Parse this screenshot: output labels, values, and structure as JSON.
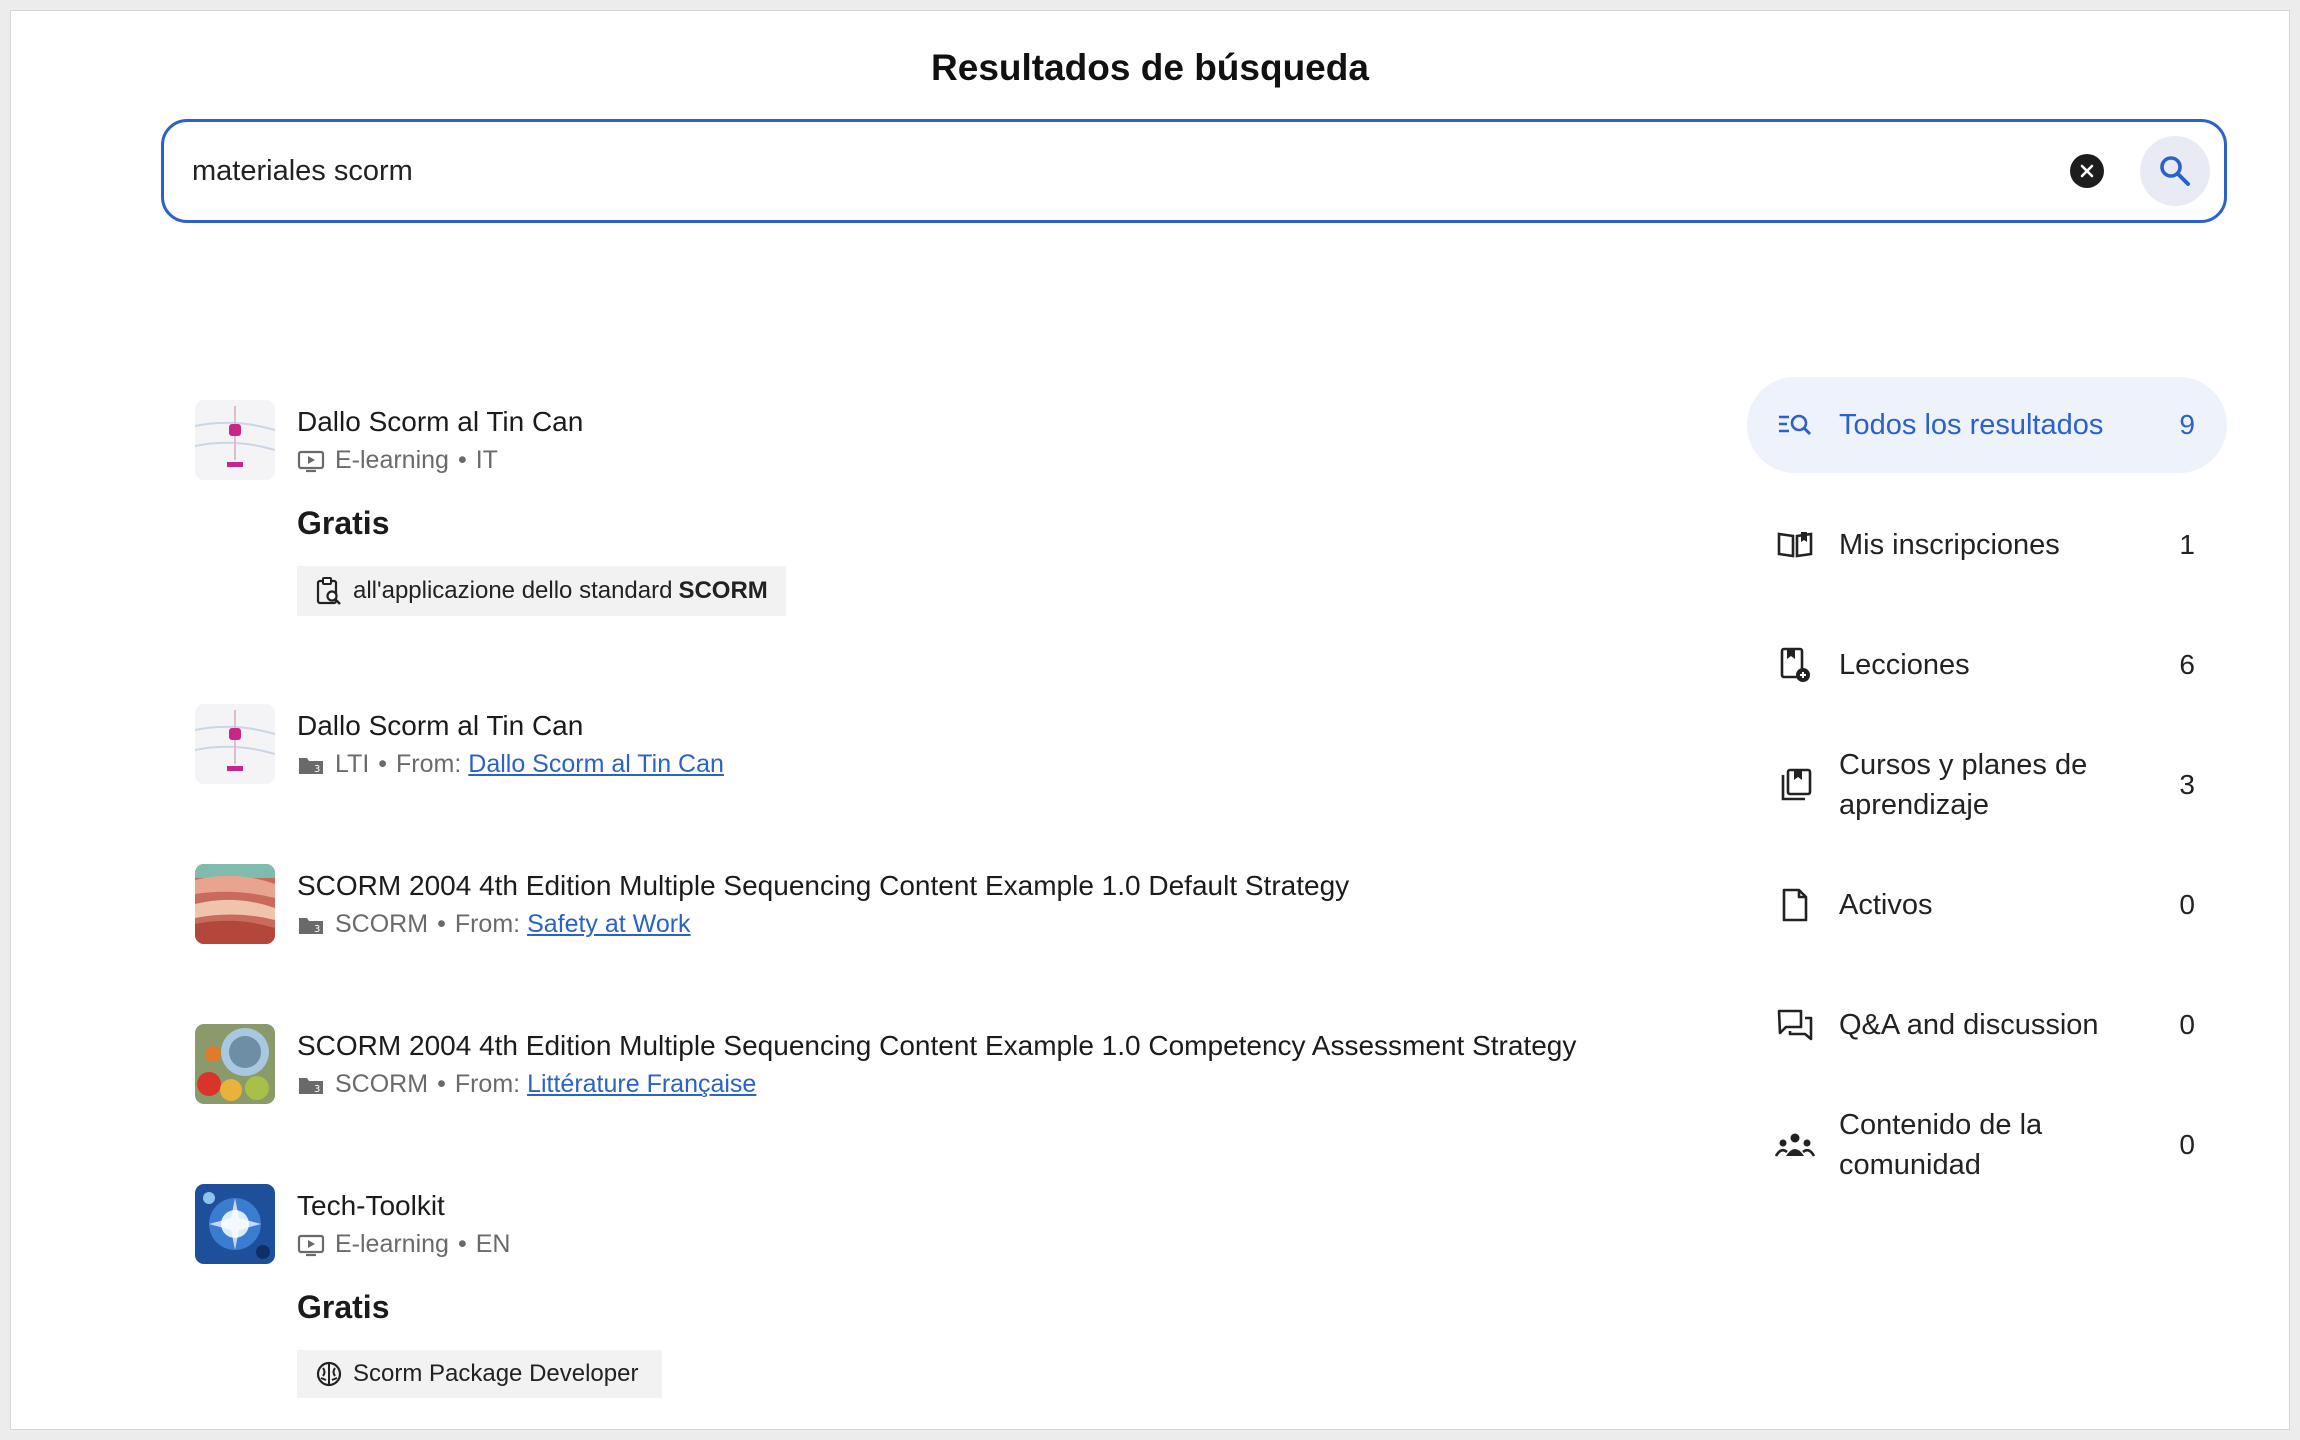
{
  "page": {
    "title": "Resultados de búsqueda"
  },
  "search": {
    "value": "materiales scorm"
  },
  "results": [
    {
      "title": "Dallo Scorm al Tin Can",
      "type": "E-learning",
      "lang": "IT",
      "price": "Gratis",
      "chip": {
        "prefix": "all'applicazione dello standard",
        "bold": "SCORM"
      },
      "icon": "play-screen-icon"
    },
    {
      "title": "Dallo Scorm al Tin Can",
      "type": "LTI",
      "from_label": "From:",
      "from_link": "Dallo Scorm al Tin Can",
      "icon": "folder-icon"
    },
    {
      "title": "SCORM 2004 4th Edition Multiple Sequencing Content Example 1.0 Default Strategy",
      "type": "SCORM",
      "from_label": "From:",
      "from_link": "Safety at Work",
      "icon": "folder-icon"
    },
    {
      "title": "SCORM 2004 4th Edition Multiple Sequencing Content Example 1.0 Competency Assessment Strategy",
      "type": "SCORM",
      "from_label": "From:",
      "from_link": "Littérature Française",
      "icon": "folder-icon"
    },
    {
      "title": "Tech-Toolkit",
      "type": "E-learning",
      "lang": "EN",
      "price": "Gratis",
      "chip": {
        "prefix": "Scorm Package Developer",
        "bold": ""
      },
      "icon": "play-screen-icon"
    }
  ],
  "filters": [
    {
      "label": "Todos los resultados",
      "count": "9",
      "icon": "list-search-icon",
      "active": true
    },
    {
      "label": "Mis inscripciones",
      "count": "1",
      "icon": "book-icon"
    },
    {
      "label": "Lecciones",
      "count": "6",
      "icon": "lesson-icon"
    },
    {
      "label": "Cursos y planes de aprendizaje",
      "count": "3",
      "icon": "course-stack-icon"
    },
    {
      "label": "Activos",
      "count": "0",
      "icon": "document-icon"
    },
    {
      "label": "Q&A and discussion",
      "count": "0",
      "icon": "chat-icon"
    },
    {
      "label": "Contenido de la comunidad",
      "count": "0",
      "icon": "community-icon"
    }
  ],
  "colors": {
    "accent": "#2a62c9",
    "active_bg": "#edf2fb"
  }
}
